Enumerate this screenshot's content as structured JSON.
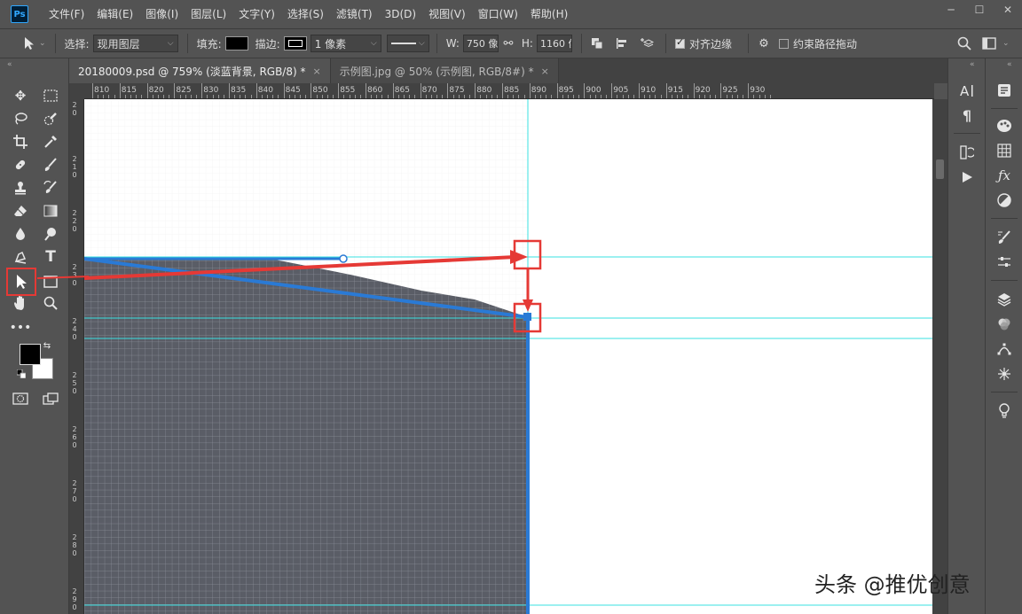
{
  "app": {
    "logo": "Ps"
  },
  "menu": [
    "文件(F)",
    "编辑(E)",
    "图像(I)",
    "图层(L)",
    "文字(Y)",
    "选择(S)",
    "滤镜(T)",
    "3D(D)",
    "视图(V)",
    "窗口(W)",
    "帮助(H)"
  ],
  "window_controls": [
    "─",
    "☐",
    "✕"
  ],
  "options": {
    "select_label": "选择:",
    "select_value": "现用图层",
    "fill_label": "填充:",
    "fill_color": "#000000",
    "stroke_label": "描边:",
    "stroke_width": "1 像素",
    "w_label": "W:",
    "w_value": "750 像",
    "h_label": "H:",
    "h_value": "1160 像",
    "align_edges_label": "对齐边缘",
    "constrain_path_label": "约束路径拖动"
  },
  "tabs": [
    {
      "label": "20180009.psd @ 759% (淡蓝背景, RGB/8) *",
      "close": "×",
      "active": true
    },
    {
      "label": "示例图.jpg @ 50% (示例图, RGB/8#) *",
      "close": "×",
      "active": false
    }
  ],
  "ruler": {
    "h_labels": [
      "810",
      "815",
      "820",
      "825",
      "830",
      "835",
      "840",
      "845",
      "850",
      "855",
      "860",
      "865",
      "870",
      "875",
      "880",
      "885",
      "890",
      "895",
      "900",
      "905",
      "910",
      "915",
      "920",
      "925",
      "930"
    ],
    "v_labels": [
      "20",
      "210",
      "220",
      "230",
      "240",
      "250",
      "260",
      "270",
      "280",
      "290"
    ]
  },
  "colors": {
    "guide": "#38e0e0",
    "path": "#2a7ad5",
    "annotation": "#e53935",
    "fill_gray": "#5a5d66"
  },
  "watermark": "头条 @推优创意"
}
